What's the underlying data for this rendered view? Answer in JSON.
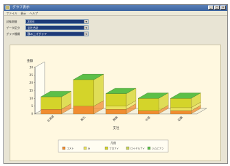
{
  "window": {
    "title": "グラフ表示",
    "menu": [
      "ファイル",
      "表示",
      "ヘルプ"
    ],
    "buttons": {
      "minimize": "_",
      "maximize": "□",
      "close": "×"
    }
  },
  "filters": [
    {
      "label": "対象期間",
      "value": "2004"
    },
    {
      "label": "データ区分",
      "value": "全社合計"
    },
    {
      "label": "グラフ種類",
      "value": "積み上げグラフ"
    }
  ],
  "colors": {
    "top": "#5cbf48",
    "front_top": "#d4d42a",
    "front_mid": "#e8e25a",
    "bottom": "#f08c30",
    "chart_bg": "#fff8e0"
  },
  "chart_data": {
    "type": "bar",
    "stacked": true,
    "three_d": true,
    "ylabel": "金額",
    "ytick_labels": [
      "30",
      "25",
      "20",
      "15",
      "10",
      "5",
      "0"
    ],
    "ylim": [
      0,
      30
    ],
    "xlabel": "支社",
    "categories": [
      "北海道",
      "東北",
      "関東",
      "中部",
      "近畿"
    ],
    "series": [
      {
        "name": "コスト",
        "values": [
          3,
          5,
          3,
          2,
          2
        ]
      },
      {
        "name": "Ja",
        "values": [
          0,
          0,
          0,
          0,
          0
        ]
      },
      {
        "name": "プロフィ",
        "values": [
          0,
          0,
          2,
          0,
          2
        ]
      },
      {
        "name": "ロイヤルティ",
        "values": [
          8,
          17,
          8,
          8,
          6
        ]
      },
      {
        "name": "ジムビアン",
        "values": [
          0,
          0,
          0,
          0,
          0
        ]
      }
    ],
    "legend_title": "凡例",
    "legend_position": "bottom",
    "grid": false
  }
}
